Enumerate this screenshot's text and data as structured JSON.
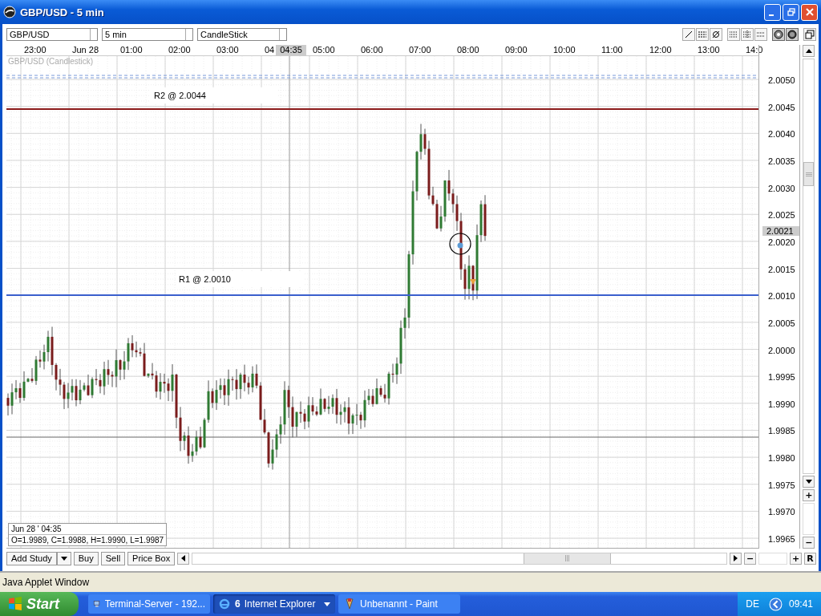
{
  "window": {
    "title": "GBP/USD - 5 min"
  },
  "toolbar": {
    "symbol": "GBP/USD",
    "interval": "5 min",
    "chart_type": "CandleStick"
  },
  "time_axis": {
    "labels": [
      "23:00",
      "Jun 28",
      "01:00",
      "02:00",
      "03:00",
      "04",
      "05:00",
      "06:00",
      "07:00",
      "08:00",
      "09:00",
      "10:00",
      "11:00",
      "12:00",
      "13:00",
      "14:0"
    ],
    "cursor_label": "04:35"
  },
  "chart": {
    "legend": "GBP/USD (Candlestick)",
    "price_labels": [
      "2.0050",
      "2.0045",
      "2.0040",
      "2.0035",
      "2.0030",
      "2.0025",
      "2.0020",
      "2.0015",
      "2.0010",
      "2.0005",
      "2.0000",
      "1.9995",
      "1.9990",
      "1.9985",
      "1.9980",
      "1.9975",
      "1.9970",
      "1.9965"
    ],
    "current_price": "2.0021",
    "lines": [
      {
        "label": "R2 @ 2.0044",
        "kind": "resistance",
        "color": "#8b1a1a"
      },
      {
        "label": "R1 @ 2.0010",
        "kind": "support",
        "color": "#3a5fcd"
      }
    ]
  },
  "info_box": {
    "date": "Jun 28 ' 04:35",
    "ohlc": "O=1.9989, C=1.9988, H=1.9990, L=1.9987"
  },
  "bottom_bar": {
    "buttons": [
      "Add Study",
      "Buy",
      "Sell",
      "Price Box"
    ],
    "zoom_out": "−",
    "zoom_in": "+",
    "reset": "R"
  },
  "price_zoom": {
    "zoom_in": "+",
    "zoom_out": "−"
  },
  "status": "Java Applet Window",
  "taskbar": {
    "start": "Start",
    "tasks": [
      {
        "label": "Terminal-Server - 192...",
        "selected": false
      },
      {
        "label": "Internet Explorer",
        "count": "6",
        "selected": true
      },
      {
        "label": "Unbenannt - Paint",
        "selected": false
      }
    ],
    "language": "DE",
    "clock": "09:41"
  }
}
